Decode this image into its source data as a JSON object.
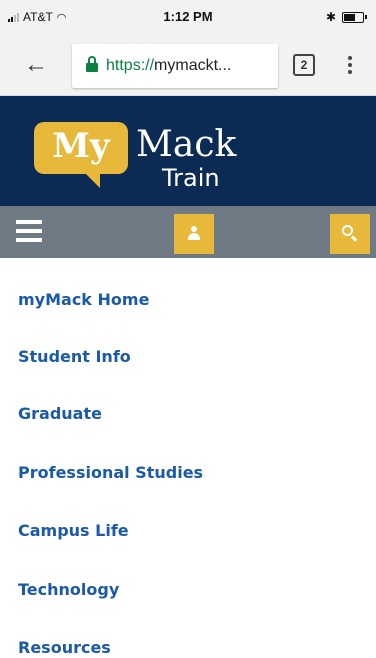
{
  "status_bar": {
    "carrier": "AT&T",
    "time": "1:12 PM"
  },
  "browser": {
    "url_scheme": "https://",
    "url_rest": "mymackt...",
    "tab_count": "2"
  },
  "header": {
    "logo_my": "My",
    "logo_mack": "Mack",
    "logo_train": "Train"
  },
  "menu": {
    "items": [
      {
        "label": "myMack Home"
      },
      {
        "label": "Student Info"
      },
      {
        "label": "Graduate"
      },
      {
        "label": "Professional Studies"
      },
      {
        "label": "Campus Life"
      },
      {
        "label": "Technology"
      },
      {
        "label": "Resources"
      }
    ]
  },
  "colors": {
    "header_bg": "#0b2b55",
    "nav_bg": "#6f7a85",
    "accent_gold": "#e8b83a",
    "link_blue": "#1a5aa8",
    "secure_green": "#0b8043"
  }
}
